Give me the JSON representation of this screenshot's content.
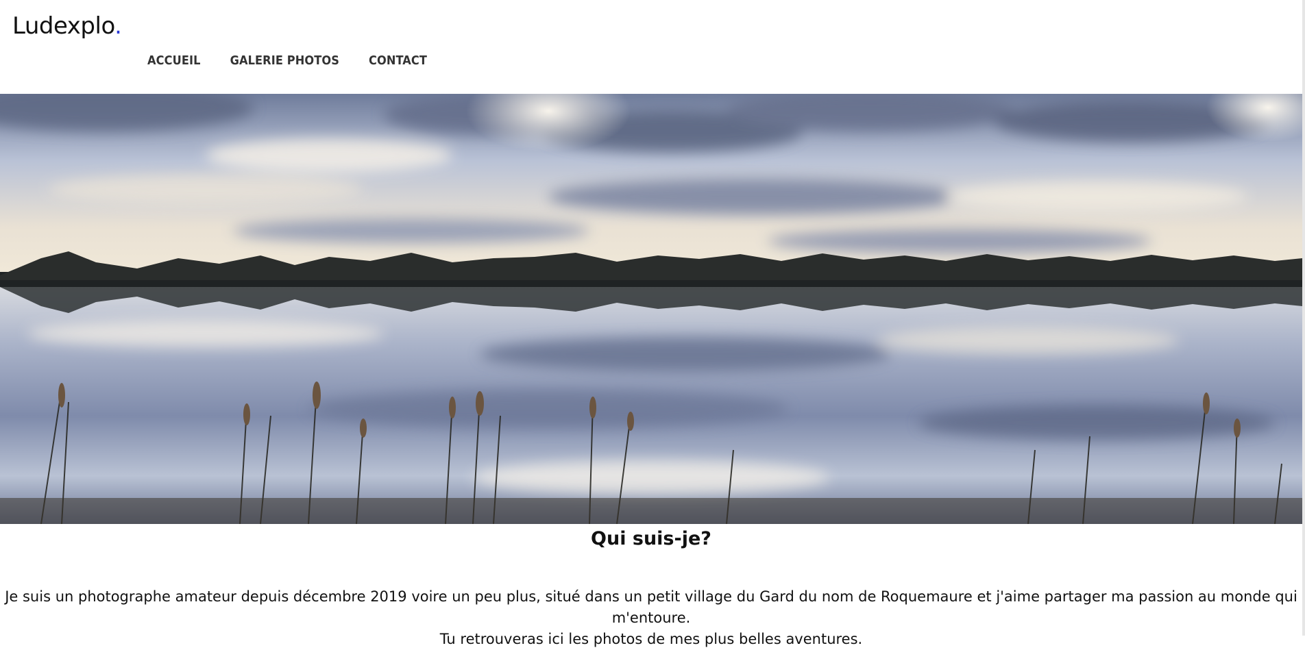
{
  "site": {
    "logo_text": "Ludexplo",
    "logo_dot": ".",
    "accent_color": "#2c3bd6"
  },
  "nav": {
    "items": [
      {
        "label": "ACCUEIL"
      },
      {
        "label": "GALERIE PHOTOS"
      },
      {
        "label": "CONTACT"
      }
    ]
  },
  "hero": {
    "image": "lake-reflection-landscape"
  },
  "about": {
    "title": "Qui suis-je?",
    "line1": "Je suis un photographe amateur depuis décembre 2019 voire un peu plus, situé dans un petit village du Gard du nom de Roquemaure et j'aime partager ma passion au monde qui m'entoure.",
    "line2": "Tu retrouveras ici les photos de mes plus belles aventures."
  }
}
